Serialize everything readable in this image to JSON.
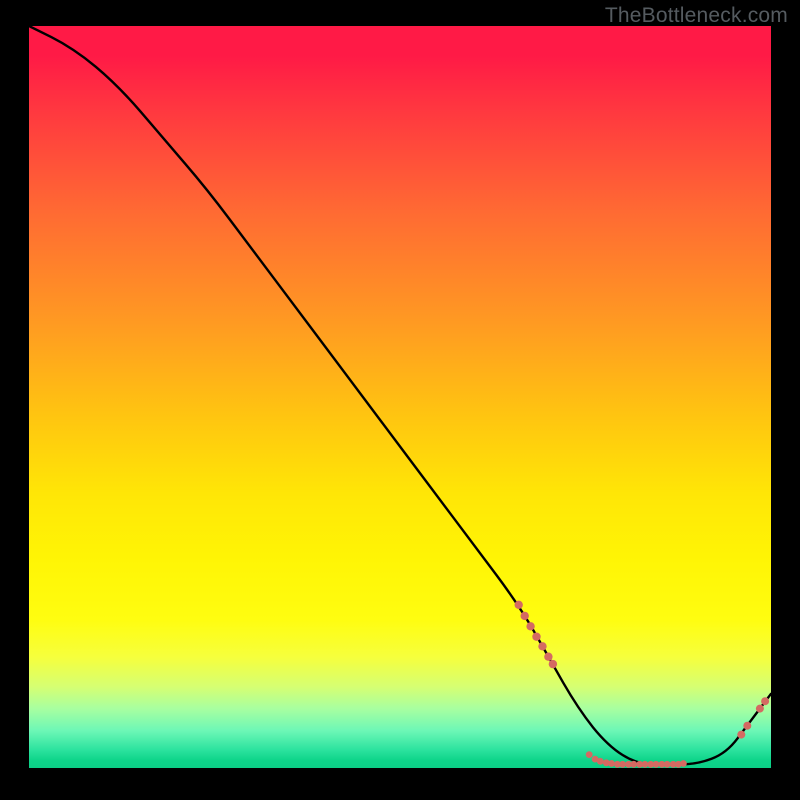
{
  "attribution": "TheBottleneck.com",
  "colors": {
    "background": "#000000",
    "gradient_top": "#ff1a46",
    "gradient_mid": "#ffe606",
    "gradient_bottom": "#0ccf86",
    "curve": "#000000",
    "marker": "#d46a62"
  },
  "chart_data": {
    "type": "line",
    "title": "",
    "xlabel": "",
    "ylabel": "",
    "xlim": [
      0,
      100
    ],
    "ylim": [
      0,
      100
    ],
    "series": [
      {
        "name": "bottleneck-curve",
        "x": [
          0,
          6,
          12,
          18,
          24,
          30,
          36,
          42,
          48,
          54,
          60,
          66,
          70,
          74,
          78,
          82,
          86,
          90,
          94,
          97,
          100
        ],
        "y": [
          100,
          97,
          92,
          85,
          78,
          70,
          62,
          54,
          46,
          38,
          30,
          22,
          15,
          8,
          3,
          0.5,
          0.5,
          0.5,
          2,
          6,
          10
        ]
      }
    ],
    "marker_clusters": [
      {
        "name": "descent-cluster",
        "points": [
          {
            "x": 66.0,
            "y": 22.0
          },
          {
            "x": 66.8,
            "y": 20.5
          },
          {
            "x": 67.6,
            "y": 19.1
          },
          {
            "x": 68.4,
            "y": 17.7
          },
          {
            "x": 69.2,
            "y": 16.4
          },
          {
            "x": 70.0,
            "y": 15.0
          },
          {
            "x": 70.6,
            "y": 14.0
          }
        ],
        "radius": 4.2
      },
      {
        "name": "valley-cluster",
        "points": [
          {
            "x": 75.5,
            "y": 1.8
          },
          {
            "x": 76.3,
            "y": 1.2
          },
          {
            "x": 77.0,
            "y": 0.9
          },
          {
            "x": 77.8,
            "y": 0.7
          },
          {
            "x": 78.5,
            "y": 0.6
          },
          {
            "x": 79.3,
            "y": 0.5
          },
          {
            "x": 80.0,
            "y": 0.5
          },
          {
            "x": 80.8,
            "y": 0.5
          },
          {
            "x": 81.5,
            "y": 0.5
          },
          {
            "x": 82.3,
            "y": 0.5
          },
          {
            "x": 83.0,
            "y": 0.5
          },
          {
            "x": 83.8,
            "y": 0.5
          },
          {
            "x": 84.5,
            "y": 0.5
          },
          {
            "x": 85.3,
            "y": 0.5
          },
          {
            "x": 86.0,
            "y": 0.5
          },
          {
            "x": 86.8,
            "y": 0.5
          },
          {
            "x": 87.5,
            "y": 0.5
          },
          {
            "x": 88.2,
            "y": 0.6
          }
        ],
        "radius": 3.4
      },
      {
        "name": "rise-cluster",
        "points": [
          {
            "x": 96.0,
            "y": 4.5
          },
          {
            "x": 96.8,
            "y": 5.7
          },
          {
            "x": 98.5,
            "y": 8.0
          },
          {
            "x": 99.2,
            "y": 9.0
          }
        ],
        "radius": 4.0
      }
    ]
  }
}
